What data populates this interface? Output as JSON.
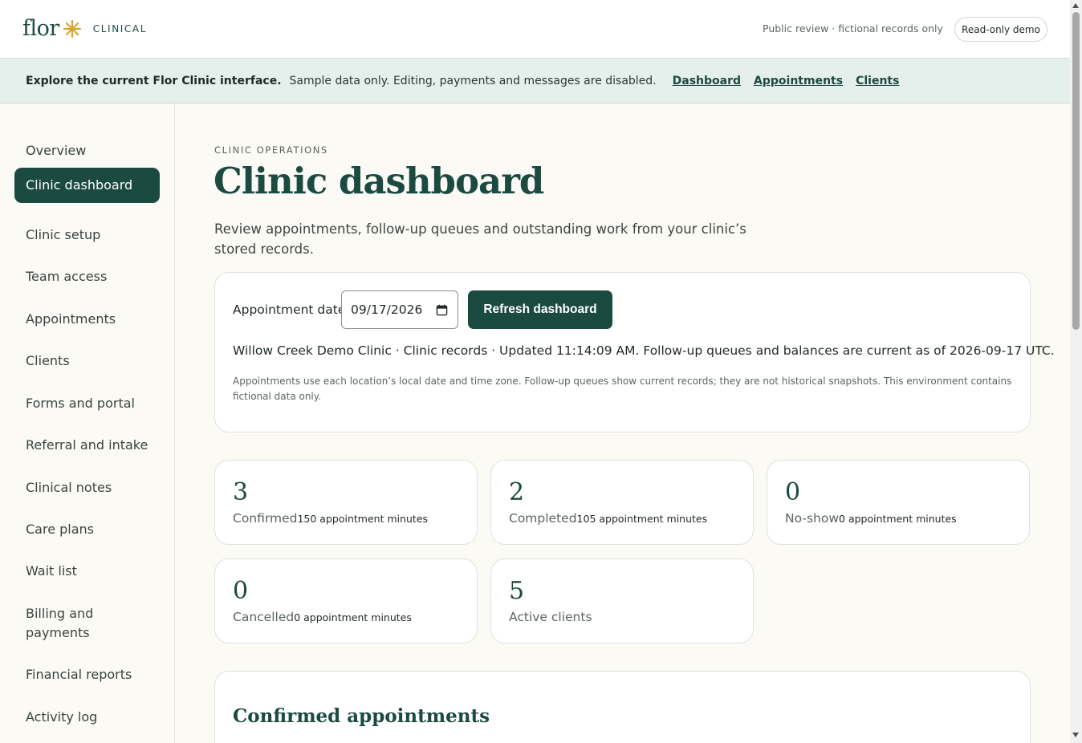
{
  "header": {
    "logo_word": "flor",
    "logo_sub": "CLINICAL",
    "note": "Public review · fictional records only",
    "badge": "Read-only demo"
  },
  "banner": {
    "strong": "Explore the current Flor Clinic interface.",
    "text": "Sample data only. Editing, payments and messages are disabled.",
    "links": [
      "Dashboard",
      "Appointments",
      "Clients"
    ]
  },
  "sidebar": {
    "items": [
      {
        "label": "Overview"
      },
      {
        "label": "Clinic dashboard",
        "active": true
      },
      {
        "label": "Clinic setup"
      },
      {
        "label": "Team access"
      },
      {
        "label": "Appointments"
      },
      {
        "label": "Clients"
      },
      {
        "label": "Forms and portal"
      },
      {
        "label": "Referral and intake"
      },
      {
        "label": "Clinical notes"
      },
      {
        "label": "Care plans"
      },
      {
        "label": "Wait list"
      },
      {
        "label": "Billing and payments"
      },
      {
        "label": "Financial reports"
      },
      {
        "label": "Activity log"
      }
    ]
  },
  "main": {
    "eyebrow": "CLINIC OPERATIONS",
    "title": "Clinic dashboard",
    "description": "Review appointments, follow-up queues and outstanding work from your clinic’s stored records.",
    "filter": {
      "date_label": "Appointment date",
      "date_value": "09/17/2026",
      "refresh_label": "Refresh dashboard",
      "status": "Willow Creek Demo Clinic · Clinic records · Updated 11:14:09 AM. Follow-up queues and balances are current as of 2026-09-17 UTC.",
      "fine_print": "Appointments use each location’s local date and time zone. Follow-up queues show current records; they are not historical snapshots. This environment contains fictional data only."
    },
    "stats": [
      {
        "value": "3",
        "label": "Confirmed",
        "sub": "150 appointment minutes"
      },
      {
        "value": "2",
        "label": "Completed",
        "sub": "105 appointment minutes"
      },
      {
        "value": "0",
        "label": "No-show",
        "sub": "0 appointment minutes"
      },
      {
        "value": "0",
        "label": "Cancelled",
        "sub": "0 appointment minutes"
      },
      {
        "value": "5",
        "label": "Active clients",
        "sub": ""
      }
    ],
    "appointments_title": "Confirmed appointments"
  },
  "colors": {
    "brand": "#1b4a40",
    "accent_star": "#d4a82a",
    "banner_bg": "#e5efec",
    "page_bg": "#fbfaf5"
  }
}
